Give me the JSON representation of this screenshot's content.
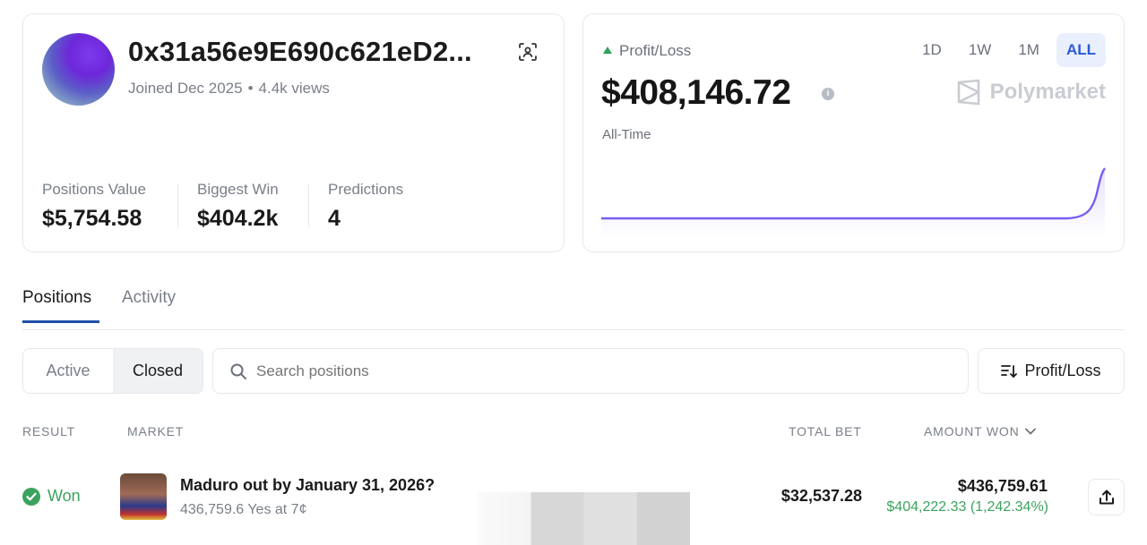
{
  "profile": {
    "name": "0x31a56e9E690c621eD2...",
    "joined": "Joined Dec 2025",
    "views": "4.4k views",
    "stats": [
      {
        "label": "Positions Value",
        "value": "$5,754.58"
      },
      {
        "label": "Biggest Win",
        "value": "$404.2k"
      },
      {
        "label": "Predictions",
        "value": "4"
      }
    ]
  },
  "pnl": {
    "label": "Profit/Loss",
    "value": "$408,146.72",
    "period_label": "All-Time",
    "brand": "Polymarket",
    "ranges": [
      "1D",
      "1W",
      "1M",
      "ALL"
    ],
    "active_range": "ALL",
    "accent_color": "#7b5cf0"
  },
  "tabs": {
    "positions": "Positions",
    "activity": "Activity"
  },
  "filters": {
    "active_label": "Active",
    "closed_label": "Closed",
    "search_placeholder": "Search positions",
    "sort_label": "Profit/Loss"
  },
  "table": {
    "headers": {
      "result": "RESULT",
      "market": "MARKET",
      "total_bet": "TOTAL BET",
      "amount_won": "AMOUNT WON"
    },
    "rows": [
      {
        "result": "Won",
        "title": "Maduro out by January 31, 2026?",
        "subtitle": "436,759.6 Yes at 7¢",
        "total_bet": "$32,537.28",
        "amount_won": "$436,759.61",
        "gain": "$404,222.33 (1,242.34%)"
      }
    ]
  }
}
